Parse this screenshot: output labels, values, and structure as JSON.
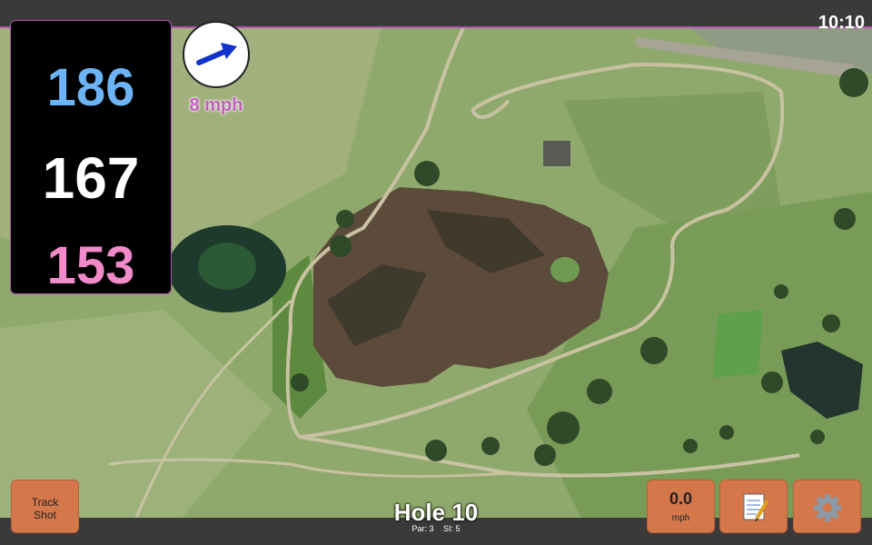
{
  "status_bar": {
    "time": "10:10"
  },
  "distances": {
    "back": "186",
    "middle": "167",
    "front": "153"
  },
  "wind": {
    "speed": "8 mph",
    "direction_icon": "wind-arrow-icon"
  },
  "buttons": {
    "track_shot_line1": "Track",
    "track_shot_line2": "Shot",
    "speed_value": "0.0",
    "speed_unit": "mph",
    "notes_icon": "notepad-icon",
    "settings_icon": "gear-icon"
  },
  "hole": {
    "title": "Hole 10",
    "par": "Par: 3",
    "si": "SI: 5"
  },
  "colors": {
    "back": "#6cb4f5",
    "middle": "#ffffff",
    "front": "#f08ac8",
    "button": "#d4774b",
    "accent": "#b056b0"
  }
}
